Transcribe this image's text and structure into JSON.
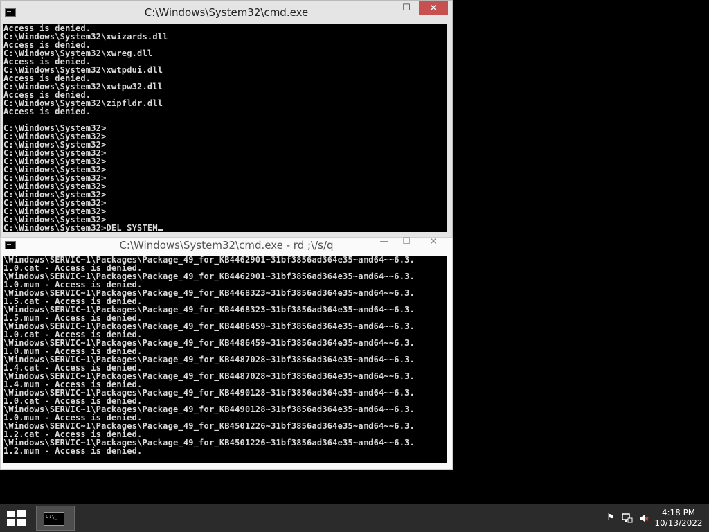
{
  "window_top": {
    "title": "C:\\Windows\\System32\\cmd.exe",
    "lines": [
      "Access is denied.",
      "C:\\Windows\\System32\\xwizards.dll",
      "Access is denied.",
      "C:\\Windows\\System32\\xwreg.dll",
      "Access is denied.",
      "C:\\Windows\\System32\\xwtpdui.dll",
      "Access is denied.",
      "C:\\Windows\\System32\\xwtpw32.dll",
      "Access is denied.",
      "C:\\Windows\\System32\\zipfldr.dll",
      "Access is denied.",
      "",
      "C:\\Windows\\System32>",
      "C:\\Windows\\System32>",
      "C:\\Windows\\System32>",
      "C:\\Windows\\System32>",
      "C:\\Windows\\System32>",
      "C:\\Windows\\System32>",
      "C:\\Windows\\System32>",
      "C:\\Windows\\System32>",
      "C:\\Windows\\System32>",
      "C:\\Windows\\System32>",
      "C:\\Windows\\System32>",
      "C:\\Windows\\System32>"
    ],
    "prompt_line": "C:\\Windows\\System32>DEL SYSTEM"
  },
  "window_bottom": {
    "title": "C:\\Windows\\System32\\cmd.exe - rd ;\\/s/q",
    "lines": [
      "\\Windows\\SERVIC~1\\Packages\\Package_49_for_KB4462901~31bf3856ad364e35~amd64~~6.3.",
      "1.0.cat - Access is denied.",
      "\\Windows\\SERVIC~1\\Packages\\Package_49_for_KB4462901~31bf3856ad364e35~amd64~~6.3.",
      "1.0.mum - Access is denied.",
      "\\Windows\\SERVIC~1\\Packages\\Package_49_for_KB4468323~31bf3856ad364e35~amd64~~6.3.",
      "1.5.cat - Access is denied.",
      "\\Windows\\SERVIC~1\\Packages\\Package_49_for_KB4468323~31bf3856ad364e35~amd64~~6.3.",
      "1.5.mum - Access is denied.",
      "\\Windows\\SERVIC~1\\Packages\\Package_49_for_KB4486459~31bf3856ad364e35~amd64~~6.3.",
      "1.0.cat - Access is denied.",
      "\\Windows\\SERVIC~1\\Packages\\Package_49_for_KB4486459~31bf3856ad364e35~amd64~~6.3.",
      "1.0.mum - Access is denied.",
      "\\Windows\\SERVIC~1\\Packages\\Package_49_for_KB4487028~31bf3856ad364e35~amd64~~6.3.",
      "1.4.cat - Access is denied.",
      "\\Windows\\SERVIC~1\\Packages\\Package_49_for_KB4487028~31bf3856ad364e35~amd64~~6.3.",
      "1.4.mum - Access is denied.",
      "\\Windows\\SERVIC~1\\Packages\\Package_49_for_KB4490128~31bf3856ad364e35~amd64~~6.3.",
      "1.0.cat - Access is denied.",
      "\\Windows\\SERVIC~1\\Packages\\Package_49_for_KB4490128~31bf3856ad364e35~amd64~~6.3.",
      "1.0.mum - Access is denied.",
      "\\Windows\\SERVIC~1\\Packages\\Package_49_for_KB4501226~31bf3856ad364e35~amd64~~6.3.",
      "1.2.cat - Access is denied.",
      "\\Windows\\SERVIC~1\\Packages\\Package_49_for_KB4501226~31bf3856ad364e35~amd64~~6.3.",
      "1.2.mum - Access is denied."
    ]
  },
  "window_controls": {
    "minimize": "—",
    "maximize": "☐",
    "close": "✕"
  },
  "taskbar": {
    "time": "4:18 PM",
    "date": "10/13/2022",
    "color": "#2b2b2b"
  },
  "icons": {
    "start": "windows-logo-icon",
    "taskbar_app": "cmd-icon",
    "flag": "action-center-flag-icon",
    "network": "network-icon",
    "volume": "volume-muted-icon"
  }
}
